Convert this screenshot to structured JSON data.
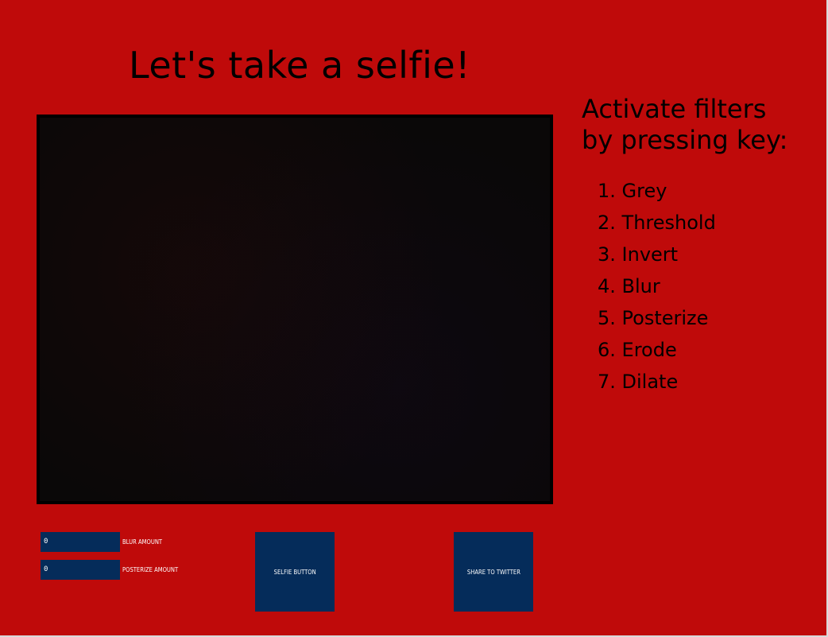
{
  "app": {
    "title": "Let's take a selfie!",
    "background_color": "#bf0a0a",
    "control_color": "#052c5a"
  },
  "instructions": {
    "heading_line1": "Activate filters",
    "heading_line2": "by pressing key:",
    "filters": [
      "1. Grey",
      "2. Threshold",
      "3. Invert",
      "4. Blur",
      "5. Posterize",
      "6. Erode",
      "7. Dilate"
    ]
  },
  "controls": {
    "blur_amount_value": "0",
    "blur_amount_label": "BLUR AMOUNT",
    "posterize_amount_value": "0",
    "posterize_amount_label": "POSTERIZE AMOUNT",
    "selfie_button_label": "SELFIE BUTTON",
    "share_button_label": "SHARE TO TWITTER"
  }
}
